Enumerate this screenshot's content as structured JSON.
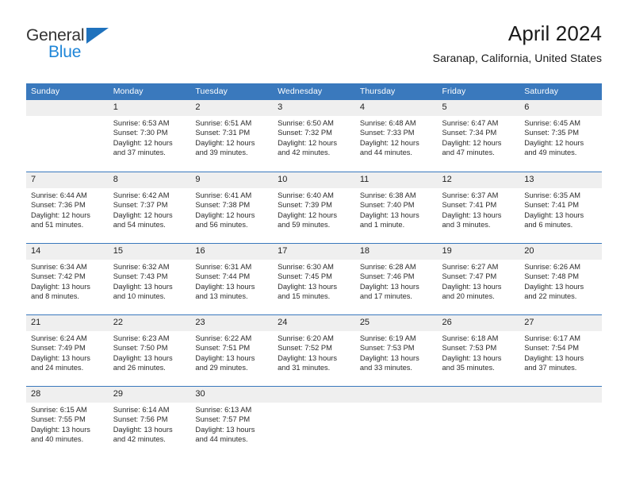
{
  "brand": {
    "name_part1": "General",
    "name_part2": "Blue",
    "triangle_icon": "triangle-icon",
    "accent_color": "#1f72bd",
    "accent_color_light": "#1f86d8"
  },
  "header": {
    "title": "April 2024",
    "location": "Saranap, California, United States"
  },
  "theme": {
    "header_blue": "#3a79bd",
    "daynum_gray": "#efefef",
    "text": "#222222"
  },
  "weekday_headers": [
    "Sunday",
    "Monday",
    "Tuesday",
    "Wednesday",
    "Thursday",
    "Friday",
    "Saturday"
  ],
  "weeks": [
    {
      "days": [
        {
          "number": "",
          "blank": true,
          "sunrise": "",
          "sunset": "",
          "daylight_line1": "",
          "daylight_line2": ""
        },
        {
          "number": "1",
          "sunrise": "Sunrise: 6:53 AM",
          "sunset": "Sunset: 7:30 PM",
          "daylight_line1": "Daylight: 12 hours",
          "daylight_line2": "and 37 minutes."
        },
        {
          "number": "2",
          "sunrise": "Sunrise: 6:51 AM",
          "sunset": "Sunset: 7:31 PM",
          "daylight_line1": "Daylight: 12 hours",
          "daylight_line2": "and 39 minutes."
        },
        {
          "number": "3",
          "sunrise": "Sunrise: 6:50 AM",
          "sunset": "Sunset: 7:32 PM",
          "daylight_line1": "Daylight: 12 hours",
          "daylight_line2": "and 42 minutes."
        },
        {
          "number": "4",
          "sunrise": "Sunrise: 6:48 AM",
          "sunset": "Sunset: 7:33 PM",
          "daylight_line1": "Daylight: 12 hours",
          "daylight_line2": "and 44 minutes."
        },
        {
          "number": "5",
          "sunrise": "Sunrise: 6:47 AM",
          "sunset": "Sunset: 7:34 PM",
          "daylight_line1": "Daylight: 12 hours",
          "daylight_line2": "and 47 minutes."
        },
        {
          "number": "6",
          "sunrise": "Sunrise: 6:45 AM",
          "sunset": "Sunset: 7:35 PM",
          "daylight_line1": "Daylight: 12 hours",
          "daylight_line2": "and 49 minutes."
        }
      ]
    },
    {
      "days": [
        {
          "number": "7",
          "sunrise": "Sunrise: 6:44 AM",
          "sunset": "Sunset: 7:36 PM",
          "daylight_line1": "Daylight: 12 hours",
          "daylight_line2": "and 51 minutes."
        },
        {
          "number": "8",
          "sunrise": "Sunrise: 6:42 AM",
          "sunset": "Sunset: 7:37 PM",
          "daylight_line1": "Daylight: 12 hours",
          "daylight_line2": "and 54 minutes."
        },
        {
          "number": "9",
          "sunrise": "Sunrise: 6:41 AM",
          "sunset": "Sunset: 7:38 PM",
          "daylight_line1": "Daylight: 12 hours",
          "daylight_line2": "and 56 minutes."
        },
        {
          "number": "10",
          "sunrise": "Sunrise: 6:40 AM",
          "sunset": "Sunset: 7:39 PM",
          "daylight_line1": "Daylight: 12 hours",
          "daylight_line2": "and 59 minutes."
        },
        {
          "number": "11",
          "sunrise": "Sunrise: 6:38 AM",
          "sunset": "Sunset: 7:40 PM",
          "daylight_line1": "Daylight: 13 hours",
          "daylight_line2": "and 1 minute."
        },
        {
          "number": "12",
          "sunrise": "Sunrise: 6:37 AM",
          "sunset": "Sunset: 7:41 PM",
          "daylight_line1": "Daylight: 13 hours",
          "daylight_line2": "and 3 minutes."
        },
        {
          "number": "13",
          "sunrise": "Sunrise: 6:35 AM",
          "sunset": "Sunset: 7:41 PM",
          "daylight_line1": "Daylight: 13 hours",
          "daylight_line2": "and 6 minutes."
        }
      ]
    },
    {
      "days": [
        {
          "number": "14",
          "sunrise": "Sunrise: 6:34 AM",
          "sunset": "Sunset: 7:42 PM",
          "daylight_line1": "Daylight: 13 hours",
          "daylight_line2": "and 8 minutes."
        },
        {
          "number": "15",
          "sunrise": "Sunrise: 6:32 AM",
          "sunset": "Sunset: 7:43 PM",
          "daylight_line1": "Daylight: 13 hours",
          "daylight_line2": "and 10 minutes."
        },
        {
          "number": "16",
          "sunrise": "Sunrise: 6:31 AM",
          "sunset": "Sunset: 7:44 PM",
          "daylight_line1": "Daylight: 13 hours",
          "daylight_line2": "and 13 minutes."
        },
        {
          "number": "17",
          "sunrise": "Sunrise: 6:30 AM",
          "sunset": "Sunset: 7:45 PM",
          "daylight_line1": "Daylight: 13 hours",
          "daylight_line2": "and 15 minutes."
        },
        {
          "number": "18",
          "sunrise": "Sunrise: 6:28 AM",
          "sunset": "Sunset: 7:46 PM",
          "daylight_line1": "Daylight: 13 hours",
          "daylight_line2": "and 17 minutes."
        },
        {
          "number": "19",
          "sunrise": "Sunrise: 6:27 AM",
          "sunset": "Sunset: 7:47 PM",
          "daylight_line1": "Daylight: 13 hours",
          "daylight_line2": "and 20 minutes."
        },
        {
          "number": "20",
          "sunrise": "Sunrise: 6:26 AM",
          "sunset": "Sunset: 7:48 PM",
          "daylight_line1": "Daylight: 13 hours",
          "daylight_line2": "and 22 minutes."
        }
      ]
    },
    {
      "days": [
        {
          "number": "21",
          "sunrise": "Sunrise: 6:24 AM",
          "sunset": "Sunset: 7:49 PM",
          "daylight_line1": "Daylight: 13 hours",
          "daylight_line2": "and 24 minutes."
        },
        {
          "number": "22",
          "sunrise": "Sunrise: 6:23 AM",
          "sunset": "Sunset: 7:50 PM",
          "daylight_line1": "Daylight: 13 hours",
          "daylight_line2": "and 26 minutes."
        },
        {
          "number": "23",
          "sunrise": "Sunrise: 6:22 AM",
          "sunset": "Sunset: 7:51 PM",
          "daylight_line1": "Daylight: 13 hours",
          "daylight_line2": "and 29 minutes."
        },
        {
          "number": "24",
          "sunrise": "Sunrise: 6:20 AM",
          "sunset": "Sunset: 7:52 PM",
          "daylight_line1": "Daylight: 13 hours",
          "daylight_line2": "and 31 minutes."
        },
        {
          "number": "25",
          "sunrise": "Sunrise: 6:19 AM",
          "sunset": "Sunset: 7:53 PM",
          "daylight_line1": "Daylight: 13 hours",
          "daylight_line2": "and 33 minutes."
        },
        {
          "number": "26",
          "sunrise": "Sunrise: 6:18 AM",
          "sunset": "Sunset: 7:53 PM",
          "daylight_line1": "Daylight: 13 hours",
          "daylight_line2": "and 35 minutes."
        },
        {
          "number": "27",
          "sunrise": "Sunrise: 6:17 AM",
          "sunset": "Sunset: 7:54 PM",
          "daylight_line1": "Daylight: 13 hours",
          "daylight_line2": "and 37 minutes."
        }
      ]
    },
    {
      "days": [
        {
          "number": "28",
          "sunrise": "Sunrise: 6:15 AM",
          "sunset": "Sunset: 7:55 PM",
          "daylight_line1": "Daylight: 13 hours",
          "daylight_line2": "and 40 minutes."
        },
        {
          "number": "29",
          "sunrise": "Sunrise: 6:14 AM",
          "sunset": "Sunset: 7:56 PM",
          "daylight_line1": "Daylight: 13 hours",
          "daylight_line2": "and 42 minutes."
        },
        {
          "number": "30",
          "sunrise": "Sunrise: 6:13 AM",
          "sunset": "Sunset: 7:57 PM",
          "daylight_line1": "Daylight: 13 hours",
          "daylight_line2": "and 44 minutes."
        },
        {
          "number": "",
          "blank": true,
          "sunrise": "",
          "sunset": "",
          "daylight_line1": "",
          "daylight_line2": ""
        },
        {
          "number": "",
          "blank": true,
          "sunrise": "",
          "sunset": "",
          "daylight_line1": "",
          "daylight_line2": ""
        },
        {
          "number": "",
          "blank": true,
          "sunrise": "",
          "sunset": "",
          "daylight_line1": "",
          "daylight_line2": ""
        },
        {
          "number": "",
          "blank": true,
          "sunrise": "",
          "sunset": "",
          "daylight_line1": "",
          "daylight_line2": ""
        }
      ]
    }
  ]
}
